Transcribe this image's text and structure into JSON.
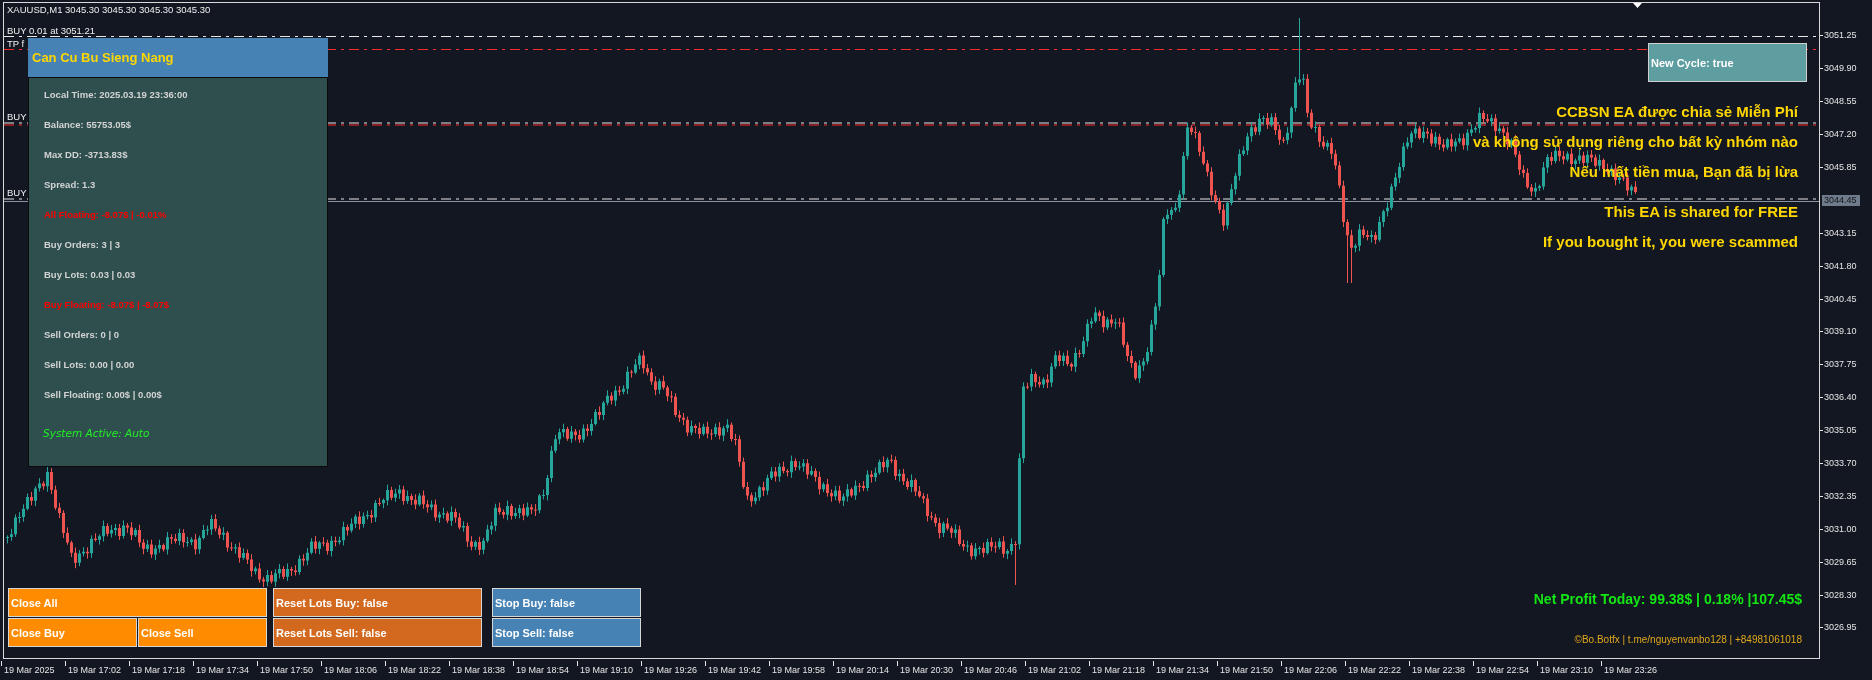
{
  "chart_header": {
    "symbol_line": "XAUUSD,M1 3045.30 3045.30 3045.30 3045.30"
  },
  "order_lines": [
    {
      "kind": "buy",
      "label": "BUY 0.01 at 3051.21"
    },
    {
      "kind": "take_profit",
      "label": "TP f"
    },
    {
      "kind": "buy",
      "label": "BUY"
    },
    {
      "kind": "take_profit"
    },
    {
      "kind": "buy",
      "label": "BUY"
    }
  ],
  "panel": {
    "title": "Can Cu Bu Sieng Nang",
    "rows": [
      {
        "text": "Local Time: 2025.03.19 23:36:00",
        "color": "#d3d3d3"
      },
      {
        "text": "Balance: 55753.05$",
        "color": "#d3d3d3"
      },
      {
        "text": "Max DD: -3713.83$",
        "color": "#d3d3d3"
      },
      {
        "text": "Spread: 1.3",
        "color": "#d3d3d3"
      },
      {
        "text": "All Floating: -8.07$ | -0.01%",
        "color": "#ff0000"
      },
      {
        "text": "Buy Orders: 3 | 3",
        "color": "#d3d3d3"
      },
      {
        "text": "Buy Lots: 0.03 | 0.03",
        "color": "#d3d3d3"
      },
      {
        "text": "Buy Floating: -8.07$ | -8.07$",
        "color": "#ff0000"
      },
      {
        "text": "Sell Orders: 0 | 0",
        "color": "#d3d3d3"
      },
      {
        "text": "Sell Lots: 0.00 | 0.00",
        "color": "#d3d3d3"
      },
      {
        "text": "Sell Floating: 0.00$ | 0.00$",
        "color": "#d3d3d3"
      }
    ],
    "status": "System Active: Auto"
  },
  "new_cycle_button": {
    "label": "New Cycle: true"
  },
  "notice": [
    {
      "lines": [
        "CCBSN EA được chia sẻ Miễn Phí",
        "và không sử dụng riêng cho bất kỳ nhóm nào",
        "Nếu mất tiền mua, Bạn đã bị lừa"
      ]
    },
    {
      "lines": [
        "This EA is shared for FREE",
        "If you bought it, you were scammed"
      ]
    }
  ],
  "net_profit": "Net Profit Today: 99.38$ | 0.18% |107.45$",
  "credit": "©Bo.Botfx | t.me/nguyenvanbo128 | +84981061018",
  "buttons": {
    "close": [
      {
        "label": "Close All"
      },
      {
        "label": "Close Buy"
      },
      {
        "label": "Close Sell"
      }
    ],
    "reset_lots": [
      {
        "label": "Reset Lots Buy: false"
      },
      {
        "label": "Reset Lots Sell: false"
      }
    ],
    "stop": [
      {
        "label": "Stop Buy: false"
      },
      {
        "label": "Stop Sell: false"
      }
    ]
  },
  "price_axis": {
    "labels": [
      {
        "text": "3051.25",
        "kind": "tick"
      },
      {
        "text": "3049.90",
        "kind": "tick"
      },
      {
        "text": "3048.55",
        "kind": "tick"
      },
      {
        "text": "3047.20",
        "kind": "tick"
      },
      {
        "text": "3045.85",
        "kind": "tick"
      },
      {
        "text": "3044.45",
        "kind": "current"
      },
      {
        "text": "3043.15",
        "kind": "tick"
      },
      {
        "text": "3041.80",
        "kind": "tick"
      },
      {
        "text": "3040.45",
        "kind": "tick"
      },
      {
        "text": "3039.10",
        "kind": "tick"
      },
      {
        "text": "3037.75",
        "kind": "tick"
      },
      {
        "text": "3036.40",
        "kind": "tick"
      },
      {
        "text": "3035.05",
        "kind": "tick"
      },
      {
        "text": "3033.70",
        "kind": "tick"
      },
      {
        "text": "3032.35",
        "kind": "tick"
      },
      {
        "text": "3031.00",
        "kind": "tick"
      },
      {
        "text": "3029.65",
        "kind": "tick"
      },
      {
        "text": "3028.30",
        "kind": "tick"
      },
      {
        "text": "3026.95",
        "kind": "tick"
      }
    ]
  },
  "time_axis": {
    "labels": [
      "19 Mar 2025",
      "19 Mar 17:02",
      "19 Mar 17:18",
      "19 Mar 17:34",
      "19 Mar 17:50",
      "19 Mar 18:06",
      "19 Mar 18:22",
      "19 Mar 18:38",
      "19 Mar 18:54",
      "19 Mar 19:10",
      "19 Mar 19:26",
      "19 Mar 19:42",
      "19 Mar 19:58",
      "19 Mar 20:14",
      "19 Mar 20:30",
      "19 Mar 20:46",
      "19 Mar 21:02",
      "19 Mar 21:18",
      "19 Mar 21:34",
      "19 Mar 21:50",
      "19 Mar 22:06",
      "19 Mar 22:22",
      "19 Mar 22:38",
      "19 Mar 22:54",
      "19 Mar 23:10",
      "19 Mar 23:26"
    ]
  }
}
